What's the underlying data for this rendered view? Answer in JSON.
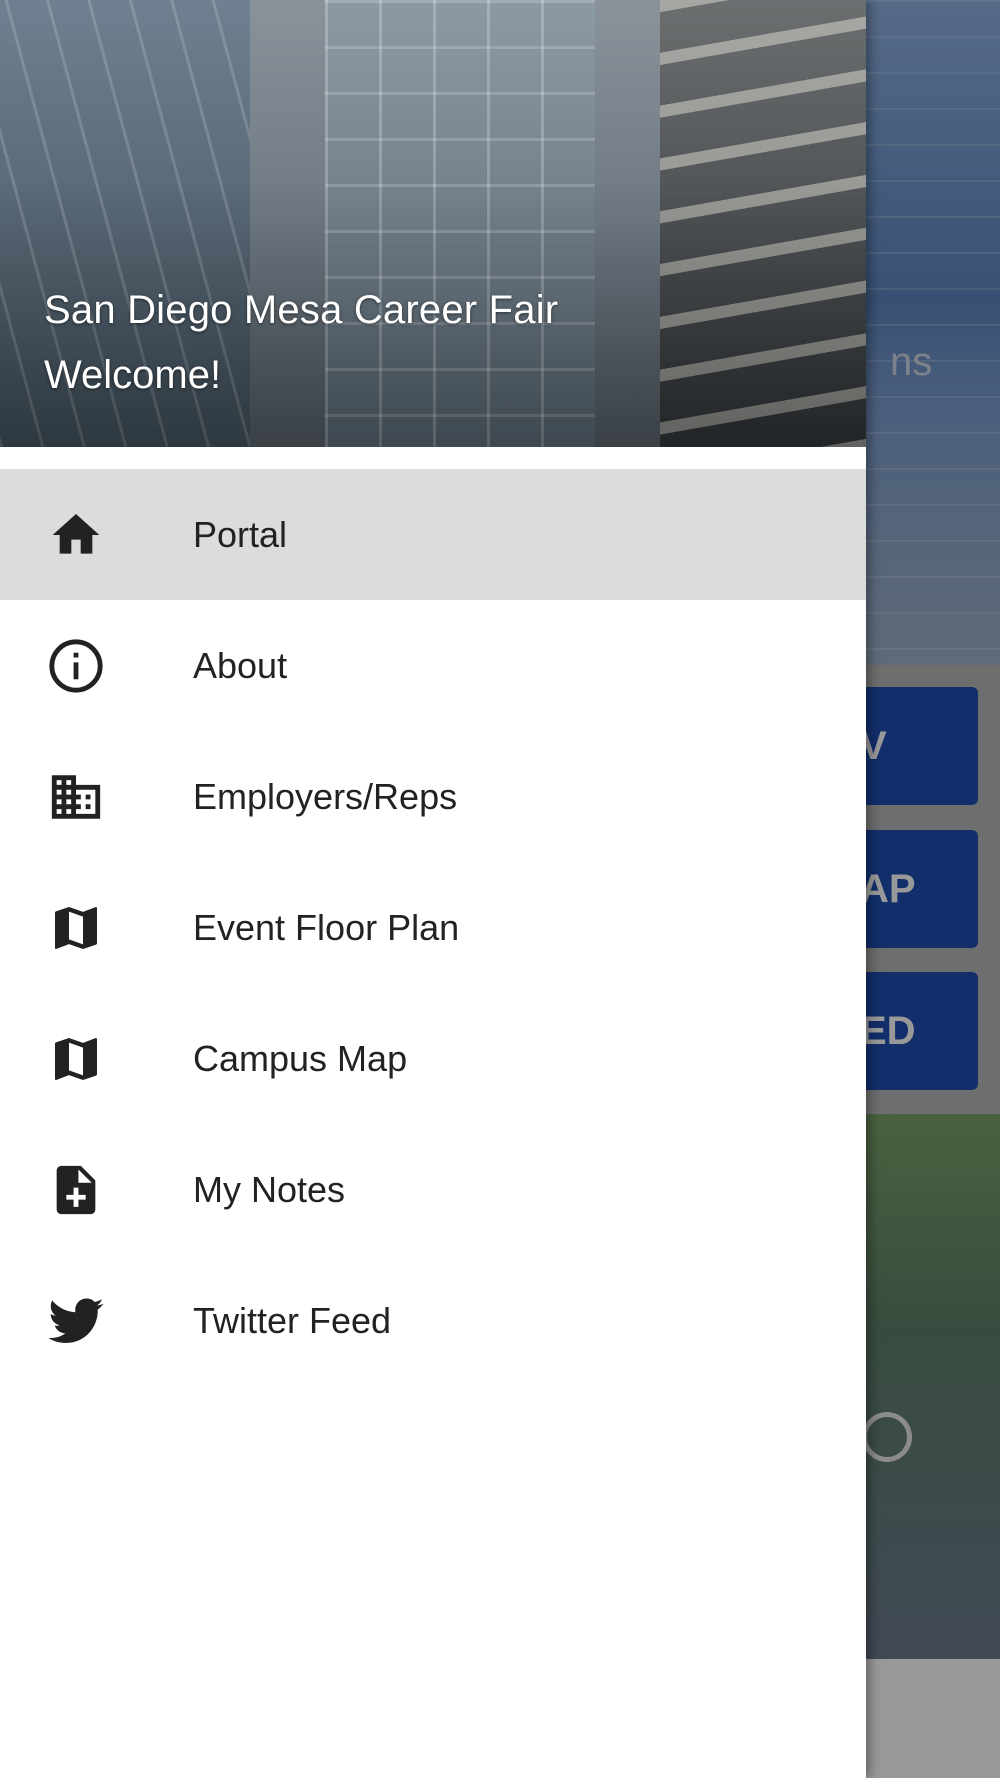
{
  "background": {
    "hero_text_fragment": "ns",
    "buttons": [
      {
        "label_fragment": "V",
        "color": "#1f4db3"
      },
      {
        "label_fragment": "AP",
        "color": "#1f4db3"
      },
      {
        "label_fragment": "ED",
        "color": "#1f4db3"
      }
    ]
  },
  "drawer": {
    "header": {
      "title": "San Diego Mesa Career Fair",
      "subtitle": "Welcome!"
    },
    "items": [
      {
        "label": "Portal",
        "icon": "home-icon",
        "active": true
      },
      {
        "label": "About",
        "icon": "info-icon",
        "active": false
      },
      {
        "label": "Employers/Reps",
        "icon": "building-icon",
        "active": false
      },
      {
        "label": "Event Floor Plan",
        "icon": "map-icon",
        "active": false
      },
      {
        "label": "Campus Map",
        "icon": "map-icon",
        "active": false
      },
      {
        "label": "My Notes",
        "icon": "note-add-icon",
        "active": false
      },
      {
        "label": "Twitter Feed",
        "icon": "twitter-icon",
        "active": false
      }
    ]
  },
  "colors": {
    "accent": "#1f4db3",
    "active_item_bg": "#dcdcdc",
    "icon": "#222222"
  }
}
